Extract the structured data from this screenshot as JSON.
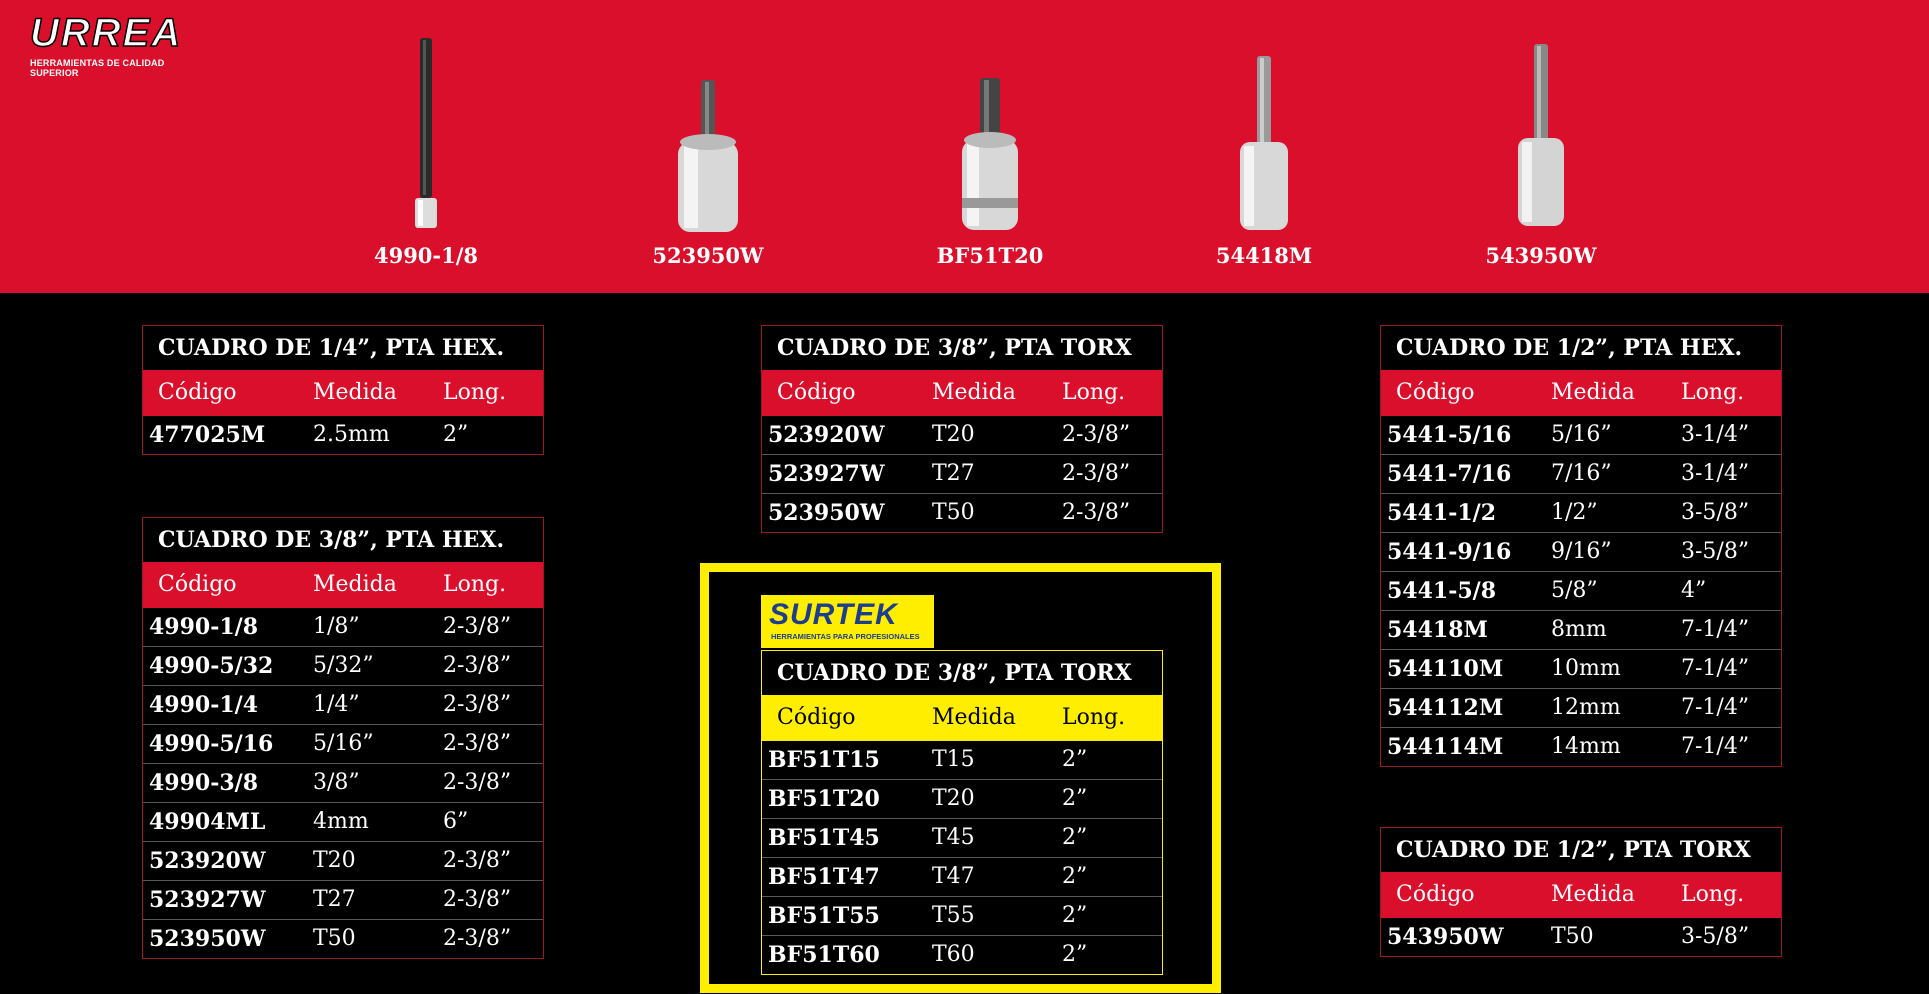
{
  "brand": {
    "logo_text": "URREA",
    "tagline": "HERRAMIENTAS DE CALIDAD SUPERIOR"
  },
  "products": [
    {
      "code": "4990-1/8"
    },
    {
      "code": "523950W"
    },
    {
      "code": "BF51T20"
    },
    {
      "code": "54418M"
    },
    {
      "code": "543950W"
    }
  ],
  "headers": {
    "code": "Código",
    "size": "Medida",
    "length": "Long."
  },
  "tables": {
    "hex14": {
      "title": "CUADRO DE 1/4”, PTA HEX.",
      "rows": [
        [
          "477025M",
          "2.5mm",
          "2”"
        ]
      ]
    },
    "hex38": {
      "title": "CUADRO DE 3/8”, PTA HEX.",
      "rows": [
        [
          "4990-1/8",
          "1/8”",
          "2-3/8”"
        ],
        [
          "4990-5/32",
          "5/32”",
          "2-3/8”"
        ],
        [
          "4990-1/4",
          "1/4”",
          "2-3/8”"
        ],
        [
          "4990-5/16",
          "5/16”",
          "2-3/8”"
        ],
        [
          "4990-3/8",
          "3/8”",
          "2-3/8”"
        ],
        [
          "49904ML",
          "4mm",
          "6”"
        ],
        [
          "523920W",
          "T20",
          "2-3/8”"
        ],
        [
          "523927W",
          "T27",
          "2-3/8”"
        ],
        [
          "523950W",
          "T50",
          "2-3/8”"
        ]
      ]
    },
    "torx38": {
      "title": "CUADRO DE 3/8”, PTA TORX",
      "rows": [
        [
          "523920W",
          "T20",
          "2-3/8”"
        ],
        [
          "523927W",
          "T27",
          "2-3/8”"
        ],
        [
          "523950W",
          "T50",
          "2-3/8”"
        ]
      ]
    },
    "surtek": {
      "logo_text": "SURTEK",
      "logo_tagline": "HERRAMIENTAS PARA PROFESIONALES",
      "title": "CUADRO DE 3/8”, PTA TORX",
      "rows": [
        [
          "BF51T15",
          "T15",
          "2”"
        ],
        [
          "BF51T20",
          "T20",
          "2”"
        ],
        [
          "BF51T45",
          "T45",
          "2”"
        ],
        [
          "BF51T47",
          "T47",
          "2”"
        ],
        [
          "BF51T55",
          "T55",
          "2”"
        ],
        [
          "BF51T60",
          "T60",
          "2”"
        ]
      ]
    },
    "hex12": {
      "title": "CUADRO DE 1/2”, PTA HEX.",
      "rows": [
        [
          "5441-5/16",
          "5/16”",
          "3-1/4”"
        ],
        [
          "5441-7/16",
          "7/16”",
          "3-1/4”"
        ],
        [
          "5441-1/2",
          "1/2”",
          "3-5/8”"
        ],
        [
          "5441-9/16",
          "9/16”",
          "3-5/8”"
        ],
        [
          "5441-5/8",
          "5/8”",
          "4”"
        ],
        [
          "54418M",
          "8mm",
          "7-1/4”"
        ],
        [
          "544110M",
          "10mm",
          "7-1/4”"
        ],
        [
          "544112M",
          "12mm",
          "7-1/4”"
        ],
        [
          "544114M",
          "14mm",
          "7-1/4”"
        ]
      ]
    },
    "torx12": {
      "title": "CUADRO DE 1/2”, PTA TORX",
      "rows": [
        [
          "543950W",
          "T50",
          "3-5/8”"
        ]
      ]
    }
  },
  "colors": {
    "urrea_red": "#d90f2c",
    "surtek_yellow": "#ffee00",
    "surtek_blue": "#1d3d8f",
    "background": "#000000"
  }
}
